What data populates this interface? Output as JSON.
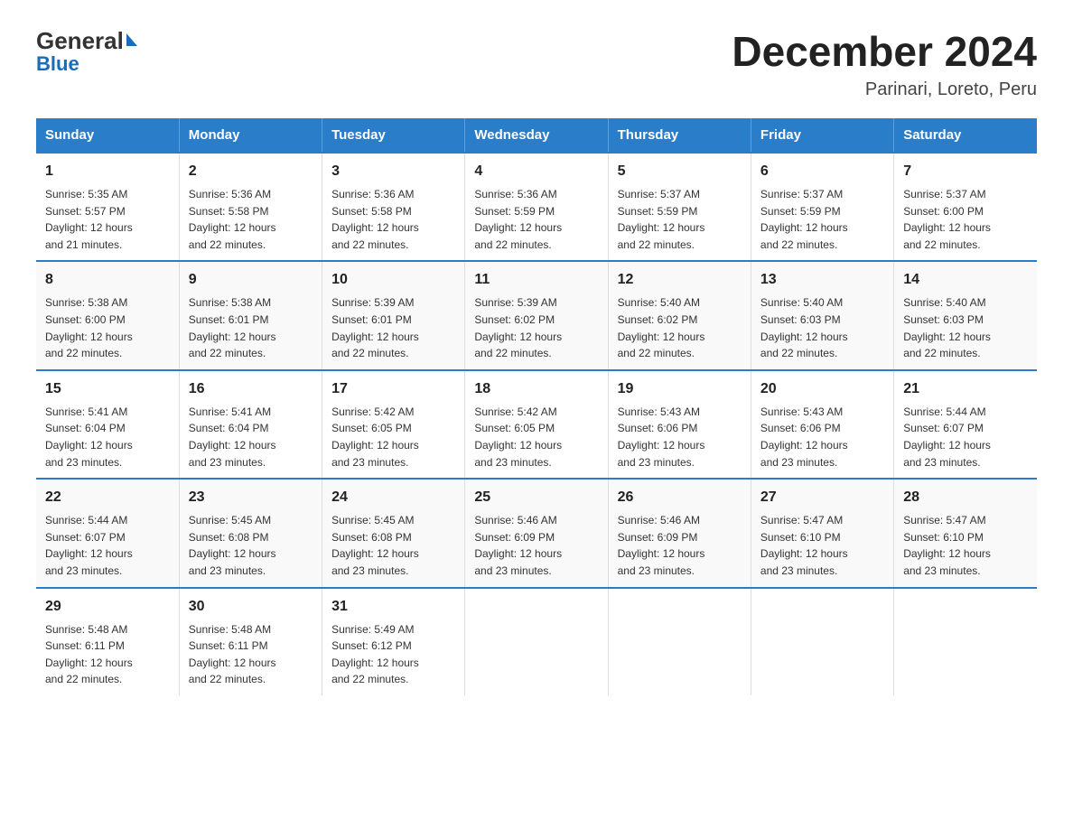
{
  "logo": {
    "general": "General",
    "blue": "Blue"
  },
  "title": "December 2024",
  "subtitle": "Parinari, Loreto, Peru",
  "days_of_week": [
    "Sunday",
    "Monday",
    "Tuesday",
    "Wednesday",
    "Thursday",
    "Friday",
    "Saturday"
  ],
  "weeks": [
    [
      {
        "day": "1",
        "sunrise": "5:35 AM",
        "sunset": "5:57 PM",
        "daylight": "12 hours and 21 minutes."
      },
      {
        "day": "2",
        "sunrise": "5:36 AM",
        "sunset": "5:58 PM",
        "daylight": "12 hours and 22 minutes."
      },
      {
        "day": "3",
        "sunrise": "5:36 AM",
        "sunset": "5:58 PM",
        "daylight": "12 hours and 22 minutes."
      },
      {
        "day": "4",
        "sunrise": "5:36 AM",
        "sunset": "5:59 PM",
        "daylight": "12 hours and 22 minutes."
      },
      {
        "day": "5",
        "sunrise": "5:37 AM",
        "sunset": "5:59 PM",
        "daylight": "12 hours and 22 minutes."
      },
      {
        "day": "6",
        "sunrise": "5:37 AM",
        "sunset": "5:59 PM",
        "daylight": "12 hours and 22 minutes."
      },
      {
        "day": "7",
        "sunrise": "5:37 AM",
        "sunset": "6:00 PM",
        "daylight": "12 hours and 22 minutes."
      }
    ],
    [
      {
        "day": "8",
        "sunrise": "5:38 AM",
        "sunset": "6:00 PM",
        "daylight": "12 hours and 22 minutes."
      },
      {
        "day": "9",
        "sunrise": "5:38 AM",
        "sunset": "6:01 PM",
        "daylight": "12 hours and 22 minutes."
      },
      {
        "day": "10",
        "sunrise": "5:39 AM",
        "sunset": "6:01 PM",
        "daylight": "12 hours and 22 minutes."
      },
      {
        "day": "11",
        "sunrise": "5:39 AM",
        "sunset": "6:02 PM",
        "daylight": "12 hours and 22 minutes."
      },
      {
        "day": "12",
        "sunrise": "5:40 AM",
        "sunset": "6:02 PM",
        "daylight": "12 hours and 22 minutes."
      },
      {
        "day": "13",
        "sunrise": "5:40 AM",
        "sunset": "6:03 PM",
        "daylight": "12 hours and 22 minutes."
      },
      {
        "day": "14",
        "sunrise": "5:40 AM",
        "sunset": "6:03 PM",
        "daylight": "12 hours and 22 minutes."
      }
    ],
    [
      {
        "day": "15",
        "sunrise": "5:41 AM",
        "sunset": "6:04 PM",
        "daylight": "12 hours and 23 minutes."
      },
      {
        "day": "16",
        "sunrise": "5:41 AM",
        "sunset": "6:04 PM",
        "daylight": "12 hours and 23 minutes."
      },
      {
        "day": "17",
        "sunrise": "5:42 AM",
        "sunset": "6:05 PM",
        "daylight": "12 hours and 23 minutes."
      },
      {
        "day": "18",
        "sunrise": "5:42 AM",
        "sunset": "6:05 PM",
        "daylight": "12 hours and 23 minutes."
      },
      {
        "day": "19",
        "sunrise": "5:43 AM",
        "sunset": "6:06 PM",
        "daylight": "12 hours and 23 minutes."
      },
      {
        "day": "20",
        "sunrise": "5:43 AM",
        "sunset": "6:06 PM",
        "daylight": "12 hours and 23 minutes."
      },
      {
        "day": "21",
        "sunrise": "5:44 AM",
        "sunset": "6:07 PM",
        "daylight": "12 hours and 23 minutes."
      }
    ],
    [
      {
        "day": "22",
        "sunrise": "5:44 AM",
        "sunset": "6:07 PM",
        "daylight": "12 hours and 23 minutes."
      },
      {
        "day": "23",
        "sunrise": "5:45 AM",
        "sunset": "6:08 PM",
        "daylight": "12 hours and 23 minutes."
      },
      {
        "day": "24",
        "sunrise": "5:45 AM",
        "sunset": "6:08 PM",
        "daylight": "12 hours and 23 minutes."
      },
      {
        "day": "25",
        "sunrise": "5:46 AM",
        "sunset": "6:09 PM",
        "daylight": "12 hours and 23 minutes."
      },
      {
        "day": "26",
        "sunrise": "5:46 AM",
        "sunset": "6:09 PM",
        "daylight": "12 hours and 23 minutes."
      },
      {
        "day": "27",
        "sunrise": "5:47 AM",
        "sunset": "6:10 PM",
        "daylight": "12 hours and 23 minutes."
      },
      {
        "day": "28",
        "sunrise": "5:47 AM",
        "sunset": "6:10 PM",
        "daylight": "12 hours and 23 minutes."
      }
    ],
    [
      {
        "day": "29",
        "sunrise": "5:48 AM",
        "sunset": "6:11 PM",
        "daylight": "12 hours and 22 minutes."
      },
      {
        "day": "30",
        "sunrise": "5:48 AM",
        "sunset": "6:11 PM",
        "daylight": "12 hours and 22 minutes."
      },
      {
        "day": "31",
        "sunrise": "5:49 AM",
        "sunset": "6:12 PM",
        "daylight": "12 hours and 22 minutes."
      },
      {
        "day": "",
        "sunrise": "",
        "sunset": "",
        "daylight": ""
      },
      {
        "day": "",
        "sunrise": "",
        "sunset": "",
        "daylight": ""
      },
      {
        "day": "",
        "sunrise": "",
        "sunset": "",
        "daylight": ""
      },
      {
        "day": "",
        "sunrise": "",
        "sunset": "",
        "daylight": ""
      }
    ]
  ],
  "labels": {
    "sunrise": "Sunrise:",
    "sunset": "Sunset:",
    "daylight": "Daylight:"
  }
}
